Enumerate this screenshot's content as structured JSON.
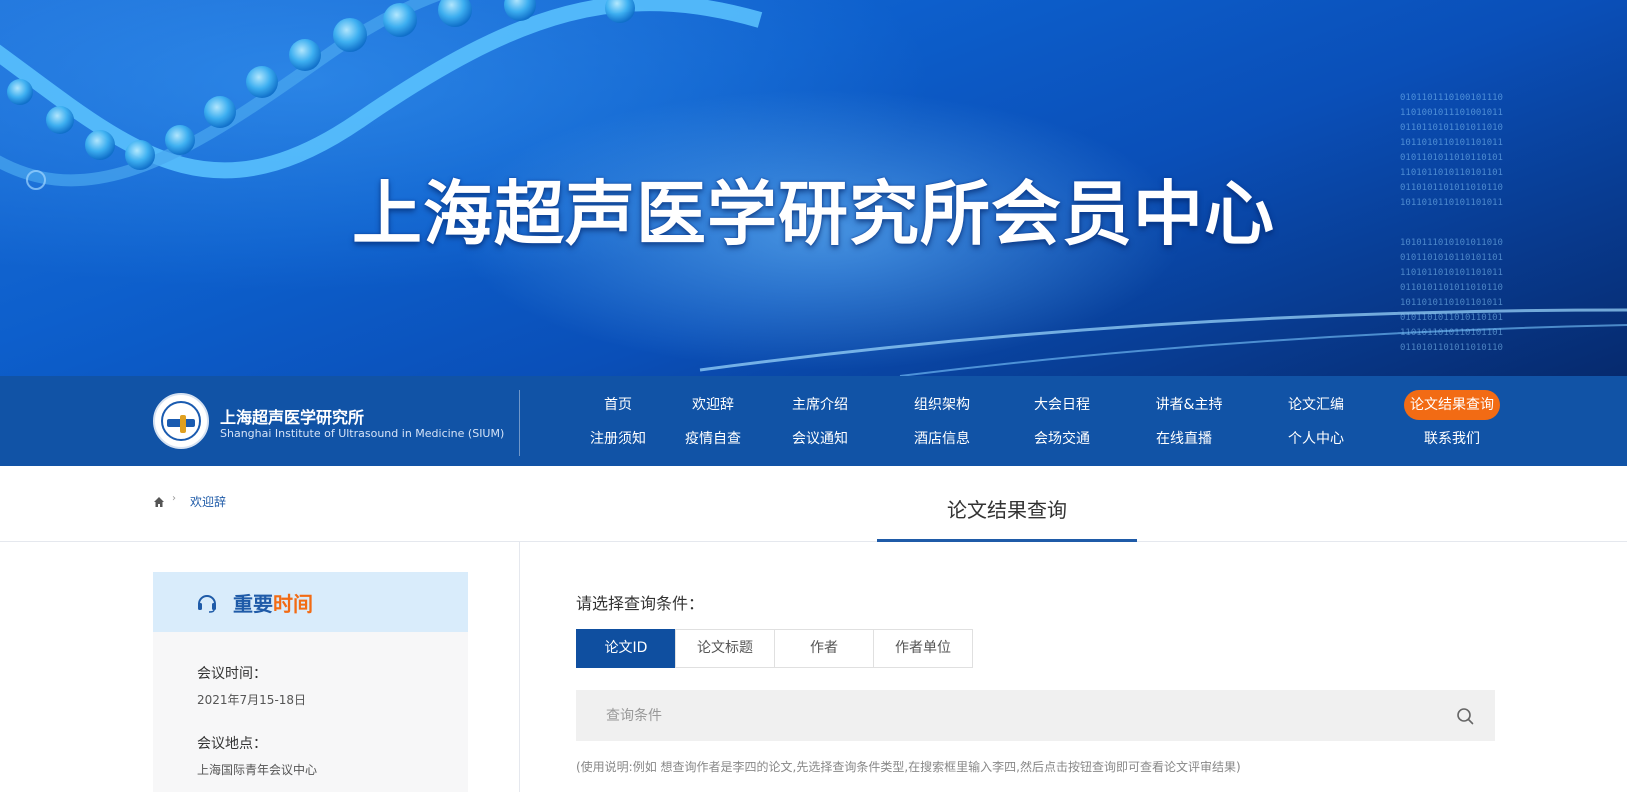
{
  "banner": {
    "title": "上海超声医学研究所会员中心"
  },
  "header": {
    "org_name_cn": "上海超声医学研究所",
    "org_name_en": "Shanghai Institute of Ultrasound in Medicine (SIUM)"
  },
  "nav": {
    "row1": [
      "首页",
      "欢迎辞",
      "主席介绍",
      "组织架构",
      "大会日程",
      "讲者&主持",
      "论文汇编",
      "论文结果查询"
    ],
    "row2": [
      "注册须知",
      "疫情自查",
      "会议通知",
      "酒店信息",
      "会场交通",
      "在线直播",
      "个人中心",
      "联系我们"
    ],
    "active": "论文结果查询"
  },
  "breadcrumb": {
    "separator": "›",
    "current": "欢迎辞"
  },
  "page": {
    "title": "论文结果查询"
  },
  "sidebar": {
    "title_part1": "重要",
    "title_part2": "时间",
    "items": [
      {
        "label": "会议时间：",
        "value": "2021年7月15-18日"
      },
      {
        "label": "会议地点：",
        "value": "上海国际青年会议中心"
      }
    ]
  },
  "query": {
    "prompt": "请选择查询条件：",
    "tabs": [
      "论文ID",
      "论文标题",
      "作者",
      "作者单位"
    ],
    "active_tab": "论文ID",
    "search_placeholder": "查询条件",
    "search_value": "",
    "instruction": "(使用说明:例如 想查询作者是李四的论文,先选择查询条件类型,在搜索框里输入李四,然后点击按钮查询即可查看论文评审结果)"
  },
  "colors": {
    "nav_bg": "#1153a6",
    "accent_orange": "#f26b14",
    "primary_blue": "#1f5ba8",
    "tab_active": "#0f4fa0"
  }
}
